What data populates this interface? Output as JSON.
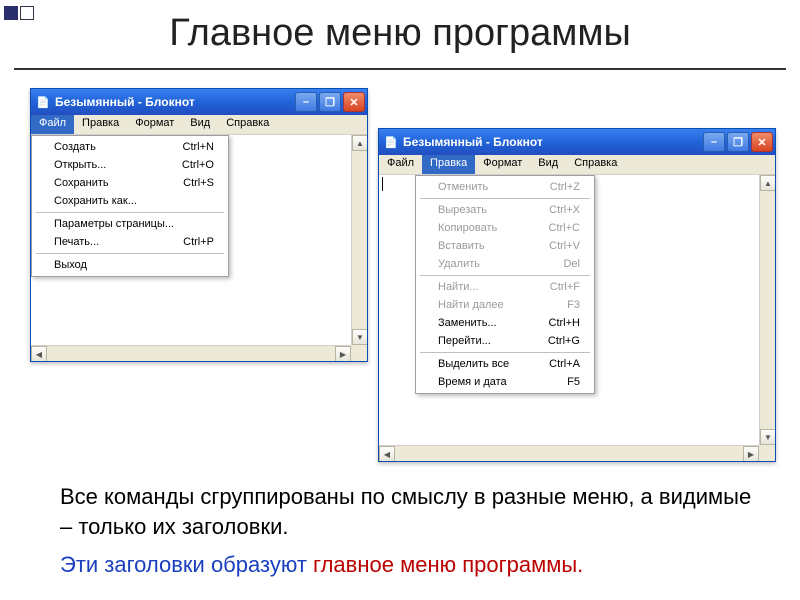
{
  "slide": {
    "title": "Главное меню программы",
    "paragraph1": "Все команды сгруппированы по смыслу в разные меню, а видимые – только их заголовки.",
    "paragraph2_part1": "Эти заголовки образуют ",
    "paragraph2_emph": "главное меню программы."
  },
  "window_common": {
    "title": "Безымянный - Блокнот",
    "menubar": [
      "Файл",
      "Правка",
      "Формат",
      "Вид",
      "Справка"
    ],
    "minimize_symbol": "–",
    "maximize_symbol": "❐",
    "close_symbol": "✕",
    "arrow_up": "▲",
    "arrow_down": "▼",
    "arrow_left": "◀",
    "arrow_right": "▶",
    "notepad_glyph": "📄"
  },
  "file_menu": {
    "active_index": 0,
    "items": [
      {
        "label": "Создать",
        "shortcut": "Ctrl+N",
        "enabled": true
      },
      {
        "label": "Открыть...",
        "shortcut": "Ctrl+O",
        "enabled": true
      },
      {
        "label": "Сохранить",
        "shortcut": "Ctrl+S",
        "enabled": true
      },
      {
        "label": "Сохранить как...",
        "shortcut": "",
        "enabled": true
      },
      {
        "sep": true
      },
      {
        "label": "Параметры страницы...",
        "shortcut": "",
        "enabled": true
      },
      {
        "label": "Печать...",
        "shortcut": "Ctrl+P",
        "enabled": true
      },
      {
        "sep": true
      },
      {
        "label": "Выход",
        "shortcut": "",
        "enabled": true
      }
    ]
  },
  "edit_menu": {
    "active_index": 1,
    "items": [
      {
        "label": "Отменить",
        "shortcut": "Ctrl+Z",
        "enabled": false
      },
      {
        "sep": true
      },
      {
        "label": "Вырезать",
        "shortcut": "Ctrl+X",
        "enabled": false
      },
      {
        "label": "Копировать",
        "shortcut": "Ctrl+C",
        "enabled": false
      },
      {
        "label": "Вставить",
        "shortcut": "Ctrl+V",
        "enabled": false
      },
      {
        "label": "Удалить",
        "shortcut": "Del",
        "enabled": false
      },
      {
        "sep": true
      },
      {
        "label": "Найти...",
        "shortcut": "Ctrl+F",
        "enabled": false
      },
      {
        "label": "Найти далее",
        "shortcut": "F3",
        "enabled": false
      },
      {
        "label": "Заменить...",
        "shortcut": "Ctrl+H",
        "enabled": true
      },
      {
        "label": "Перейти...",
        "shortcut": "Ctrl+G",
        "enabled": true
      },
      {
        "sep": true
      },
      {
        "label": "Выделить все",
        "shortcut": "Ctrl+A",
        "enabled": true
      },
      {
        "label": "Время и дата",
        "shortcut": "F5",
        "enabled": true
      }
    ]
  }
}
